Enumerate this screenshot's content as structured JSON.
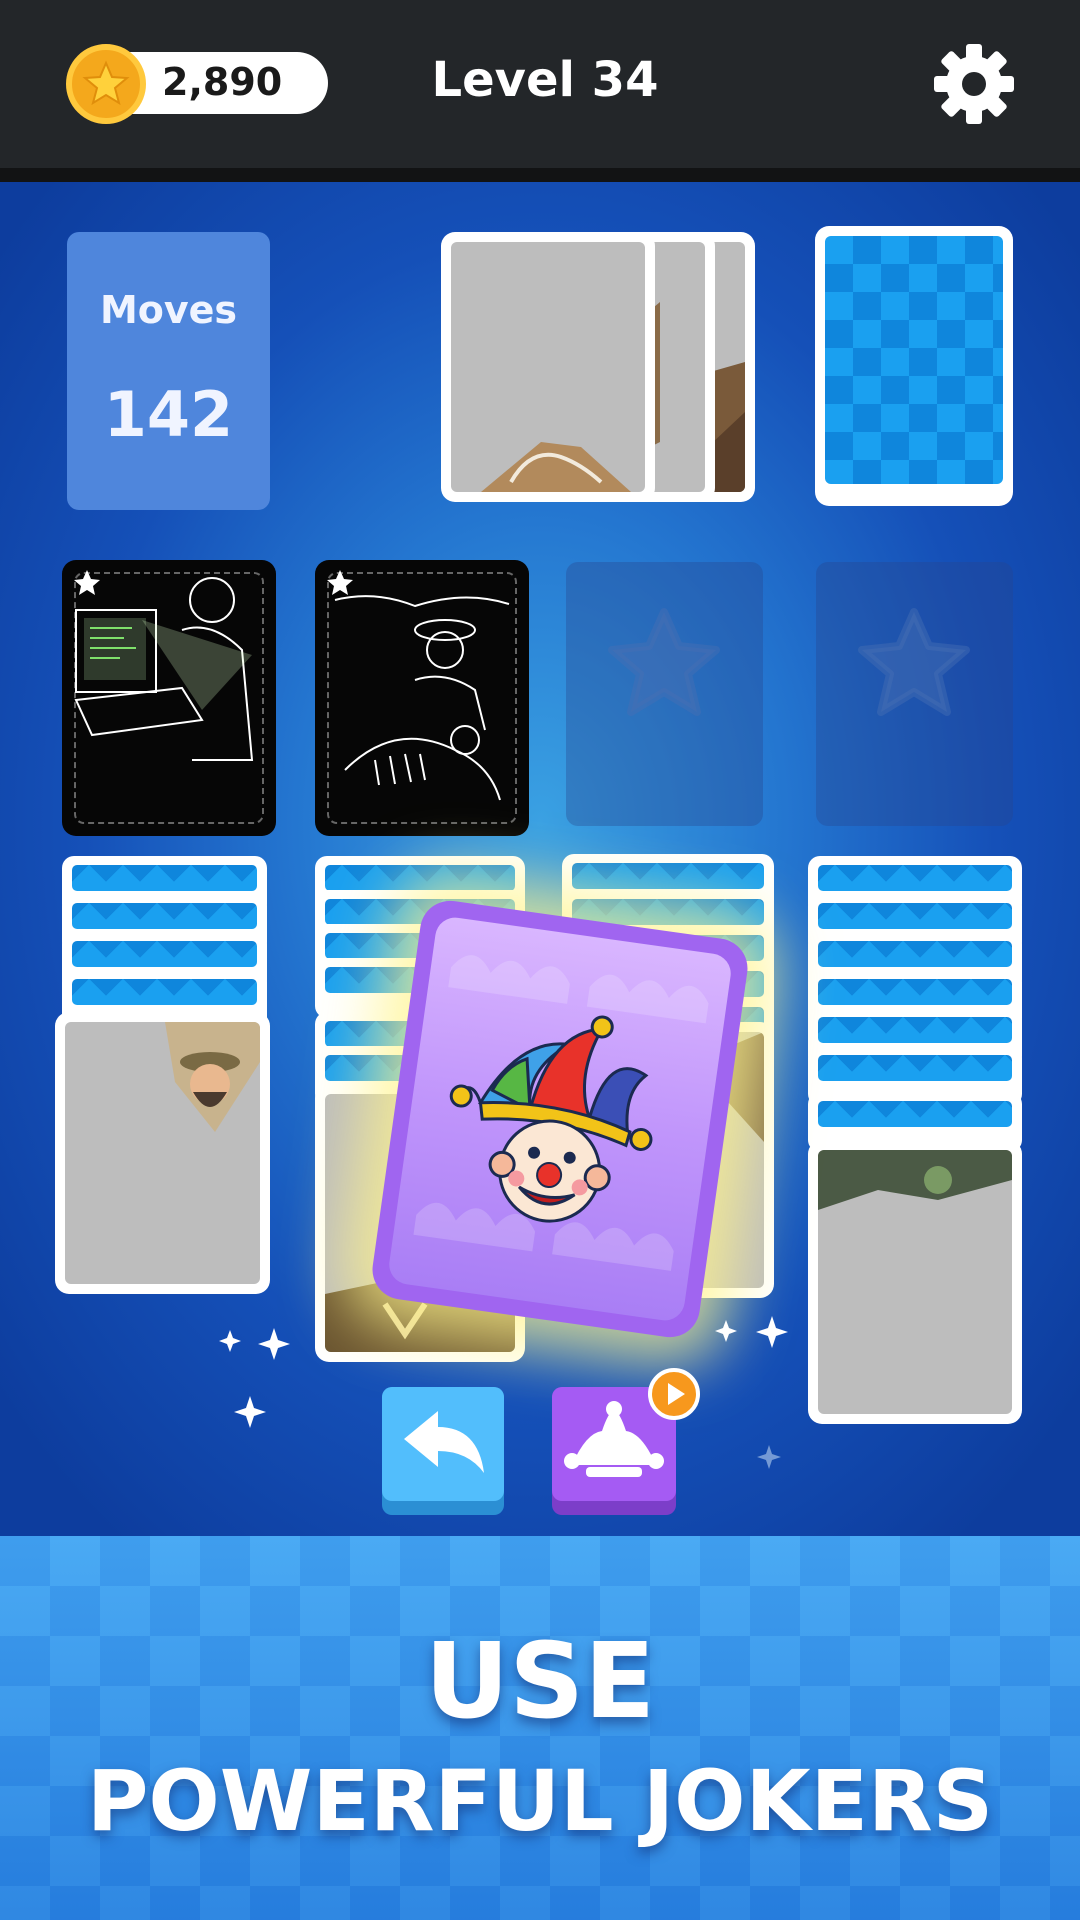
{
  "header": {
    "coins": "2,890",
    "level_title": "Level 34",
    "settings_icon": "gear-icon",
    "coin_icon": "star-coin-icon"
  },
  "stats": {
    "moves_label": "Moves",
    "moves_value": "142"
  },
  "piles": {
    "waste": {
      "visible_cards": 3
    },
    "stock": {
      "state": "face-down"
    },
    "foundations": [
      {
        "slot": 1,
        "state": "filled",
        "art": "computer-user-sketch",
        "icon": "star-icon"
      },
      {
        "slot": 2,
        "state": "filled",
        "art": "paleontologist-sketch",
        "icon": "star-icon"
      },
      {
        "slot": 3,
        "state": "empty",
        "icon": "star-icon"
      },
      {
        "slot": 4,
        "state": "empty",
        "icon": "star-icon"
      }
    ],
    "tableau": [
      {
        "column": 1,
        "face_down": 4,
        "face_up": 1
      },
      {
        "column": 2,
        "face_down": 6,
        "face_up": 1
      },
      {
        "column": 3,
        "face_down": 5,
        "face_up": 1
      },
      {
        "column": 4,
        "face_down": 7,
        "face_up": 1
      }
    ]
  },
  "joker_card": {
    "icon": "jester-clown-icon"
  },
  "controls": {
    "undo_icon": "undo-arrow-icon",
    "joker_icon": "jester-hat-icon",
    "joker_badge_icon": "play-video-icon"
  },
  "banner": {
    "line1": "USE",
    "line2": "POWERFUL JOKERS"
  },
  "colors": {
    "topbar": "#232629",
    "moves_box": "#4f86dc",
    "card_back": "#1aa0f0",
    "joker_card": "#a065f0",
    "undo_button": "#52befc",
    "joker_button": "#a55bf3",
    "badge": "#f7981d"
  }
}
